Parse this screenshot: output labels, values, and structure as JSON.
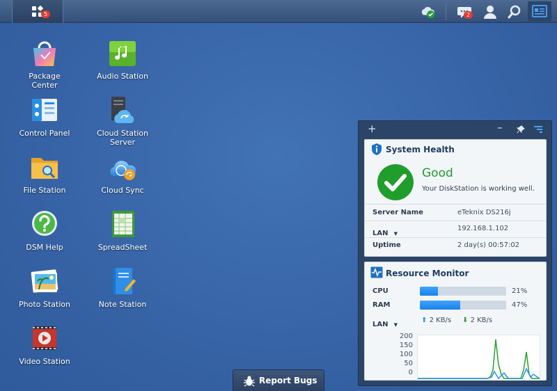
{
  "taskbar": {
    "main_menu_badge": "5",
    "notifications_badge": "2"
  },
  "desktop": {
    "apps": [
      {
        "label": "Package\nCenter",
        "icon": "package-center-icon"
      },
      {
        "label": "Audio Station",
        "icon": "audio-station-icon"
      },
      {
        "label": "Control Panel",
        "icon": "control-panel-icon"
      },
      {
        "label": "Cloud Station Server",
        "icon": "cloud-station-server-icon"
      },
      {
        "label": "File Station",
        "icon": "file-station-icon"
      },
      {
        "label": "Cloud Sync",
        "icon": "cloud-sync-icon"
      },
      {
        "label": "DSM Help",
        "icon": "dsm-help-icon"
      },
      {
        "label": "SpreadSheet",
        "icon": "spreadsheet-icon"
      },
      {
        "label": "Photo Station",
        "icon": "photo-station-icon"
      },
      {
        "label": "Note Station",
        "icon": "note-station-icon"
      },
      {
        "label": "Video Station",
        "icon": "video-station-icon"
      }
    ]
  },
  "widgets": {
    "system_health": {
      "title": "System Health",
      "status": "Good",
      "message": "Your DiskStation is working well.",
      "rows": [
        {
          "label": "Server Name",
          "value": "eTeknix DS216j"
        },
        {
          "label": "LAN",
          "value": "192.168.1.102"
        },
        {
          "label": "Uptime",
          "value": "2 day(s) 00:57:02"
        }
      ]
    },
    "resource_monitor": {
      "title": "Resource Monitor",
      "cpu_label": "CPU",
      "cpu_pct": "21%",
      "cpu_value": 0.21,
      "ram_label": "RAM",
      "ram_pct": "47%",
      "ram_value": 0.47,
      "lan_label": "LAN",
      "upload": "2 KB/s",
      "download": "2 KB/s",
      "y_ticks": [
        "200",
        "150",
        "100",
        "50",
        "0"
      ]
    }
  },
  "report_bugs": {
    "label": "Report Bugs"
  },
  "colors": {
    "desktop": "#3a67a8",
    "good": "#1f9e2c",
    "bar": "#2a8ef0"
  }
}
